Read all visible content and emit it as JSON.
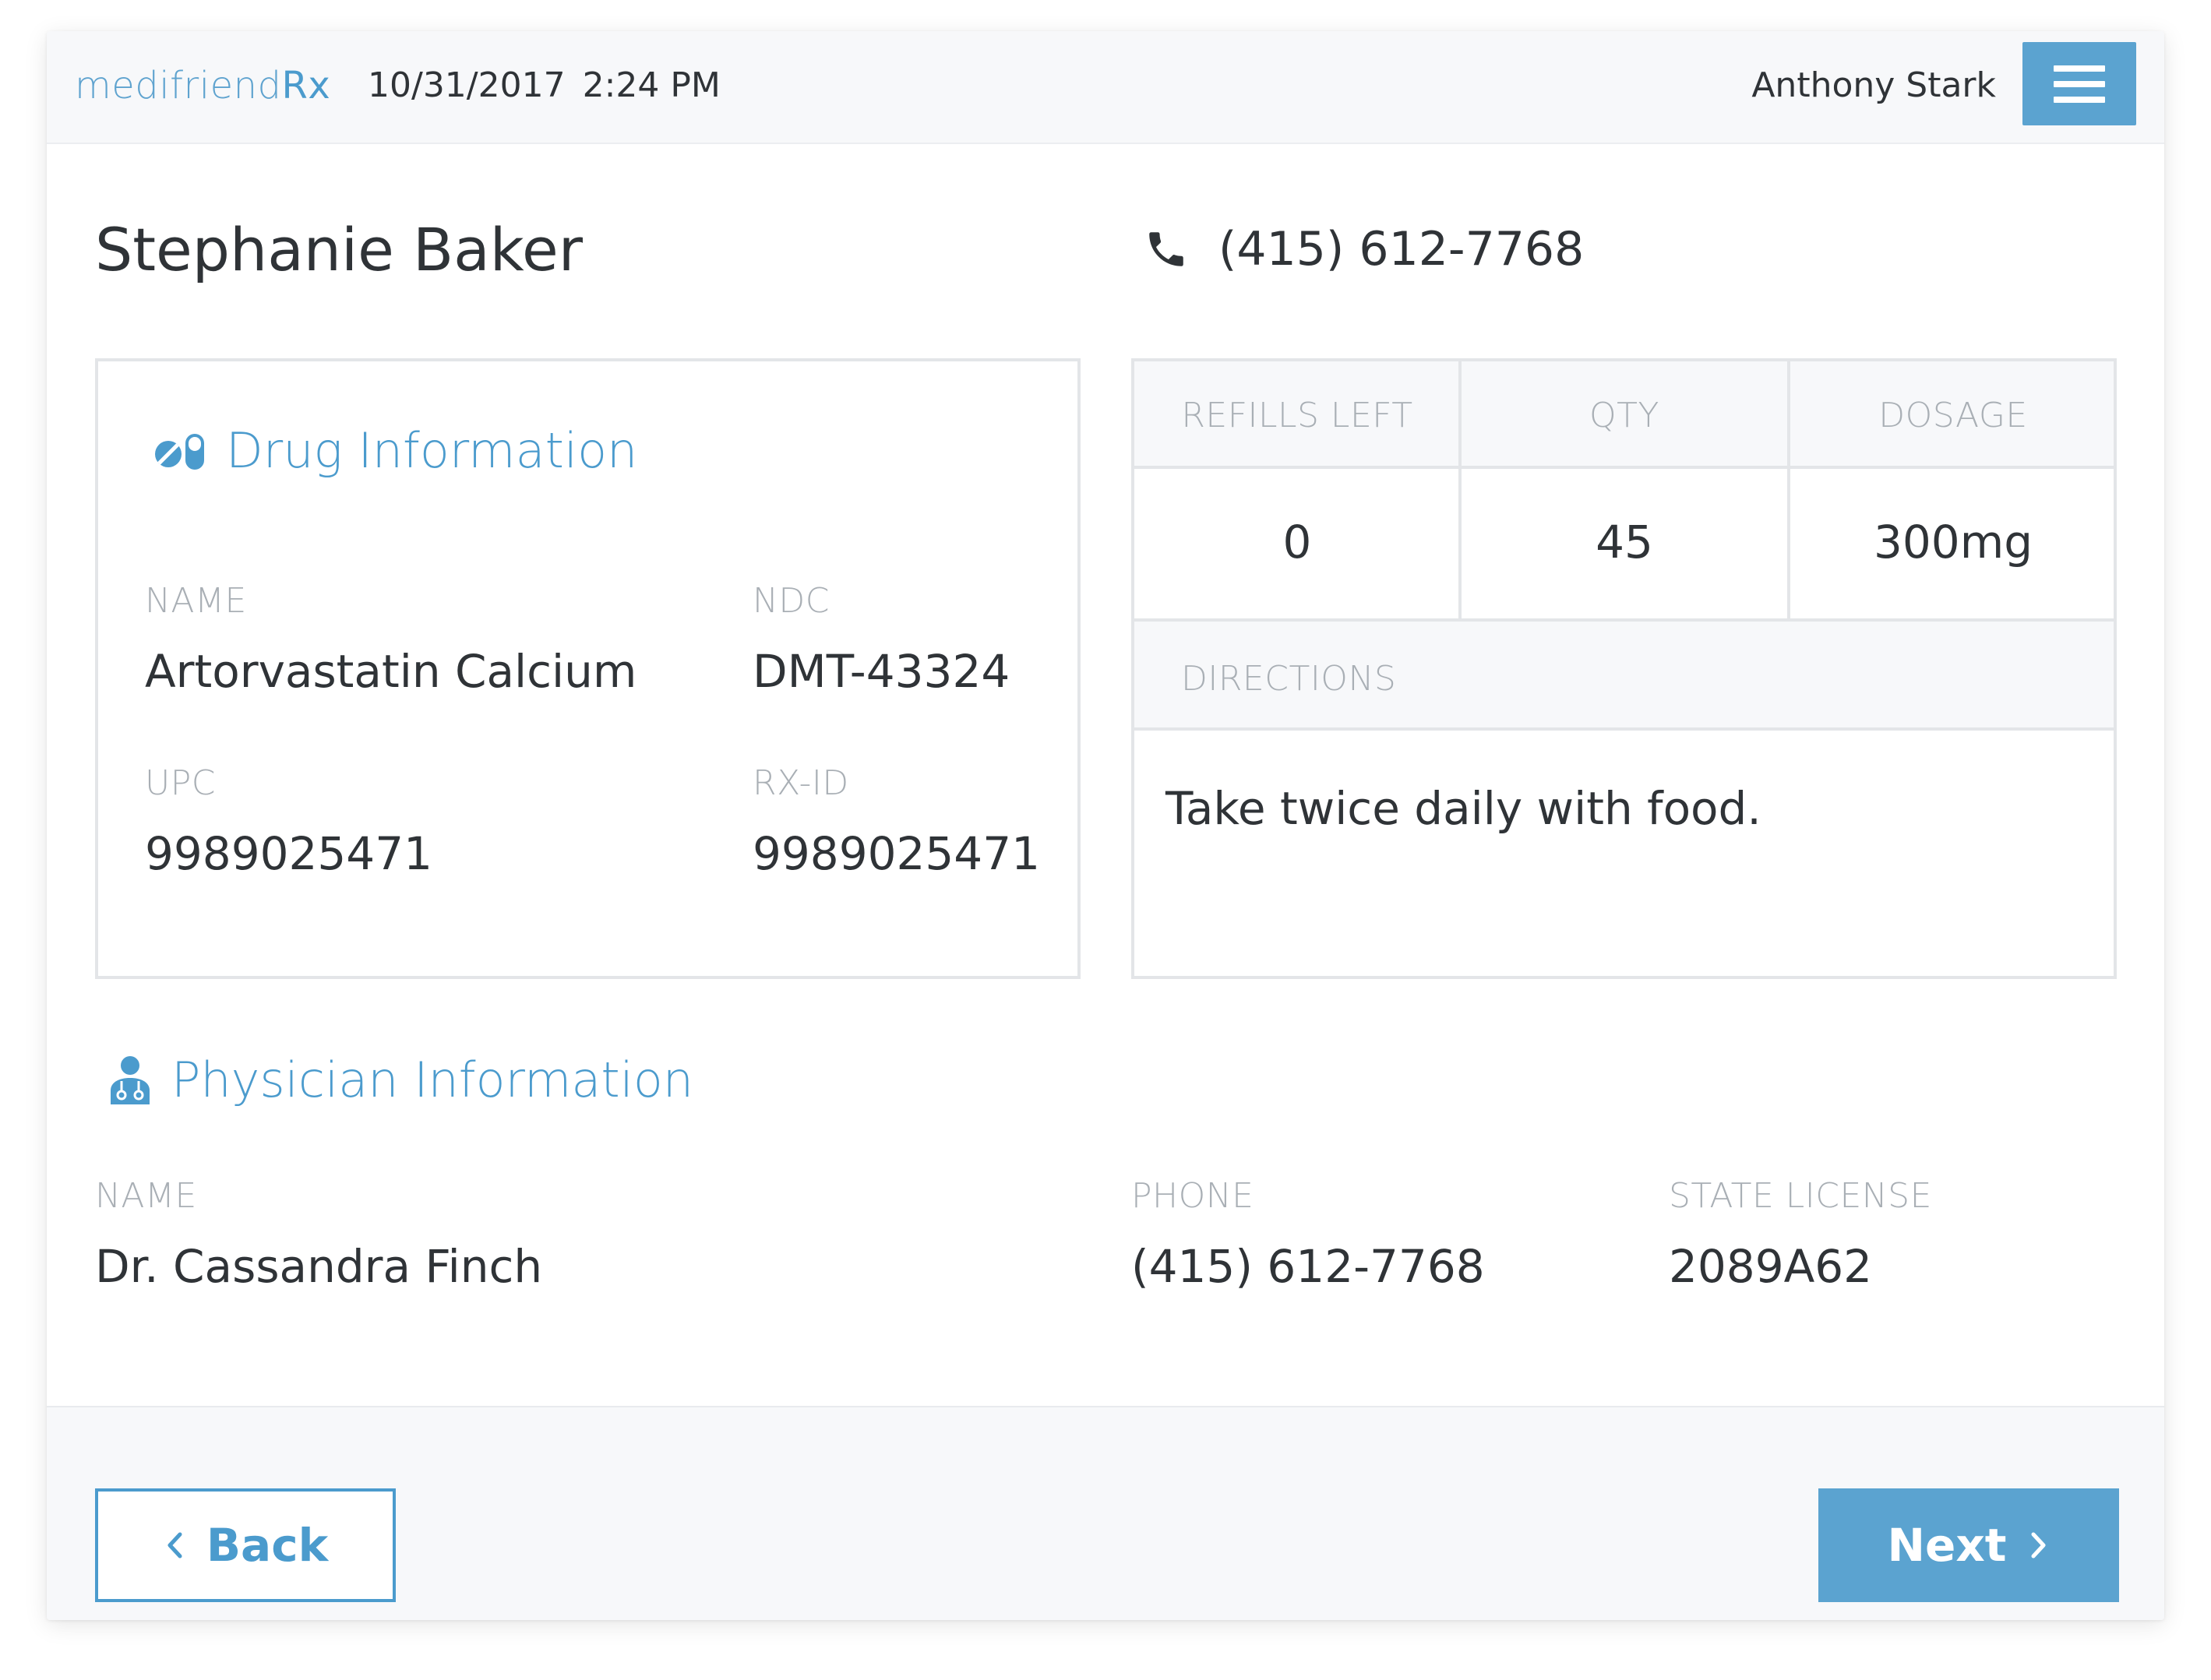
{
  "header": {
    "logo_main": "medifriend",
    "logo_suffix": "Rx",
    "date": "10/31/2017",
    "time": "2:24 PM",
    "user_name": "Anthony Stark",
    "menu_icon": "hamburger-menu-icon"
  },
  "patient": {
    "name": "Stephanie Baker",
    "phone": "(415) 612-7768",
    "phone_icon": "phone-icon"
  },
  "drug": {
    "title": "Drug Information",
    "icon": "pill-icon",
    "name_label": "NAME",
    "name_value": "Artorvastatin Calcium",
    "ndc_label": "NDC",
    "ndc_value": "DMT-43324",
    "upc_label": "UPC",
    "upc_value": "9989025471",
    "rxid_label": "RX-ID",
    "rxid_value": "9989025471"
  },
  "rx": {
    "refills_label": "REFILLS LEFT",
    "refills_value": "0",
    "qty_label": "QTY",
    "qty_value": "45",
    "dosage_label": "DOSAGE",
    "dosage_value": "300mg",
    "directions_label": "DIRECTIONS",
    "directions_value": "Take twice daily with food."
  },
  "physician": {
    "title": "Physician Information",
    "icon": "doctor-icon",
    "name_label": "NAME",
    "name_value": "Dr. Cassandra Finch",
    "phone_label": "PHONE",
    "phone_value": "(415) 612-7768",
    "license_label": "STATE LICENSE",
    "license_value": "2089A62"
  },
  "footer": {
    "back_label": "Back",
    "next_label": "Next",
    "back_icon": "chevron-left-icon",
    "next_icon": "chevron-right-icon"
  },
  "colors": {
    "accent": "#5ba3d0",
    "accent_text": "#4b9bcd",
    "label_gray": "#a9afb5",
    "border": "#e3e5e8"
  }
}
